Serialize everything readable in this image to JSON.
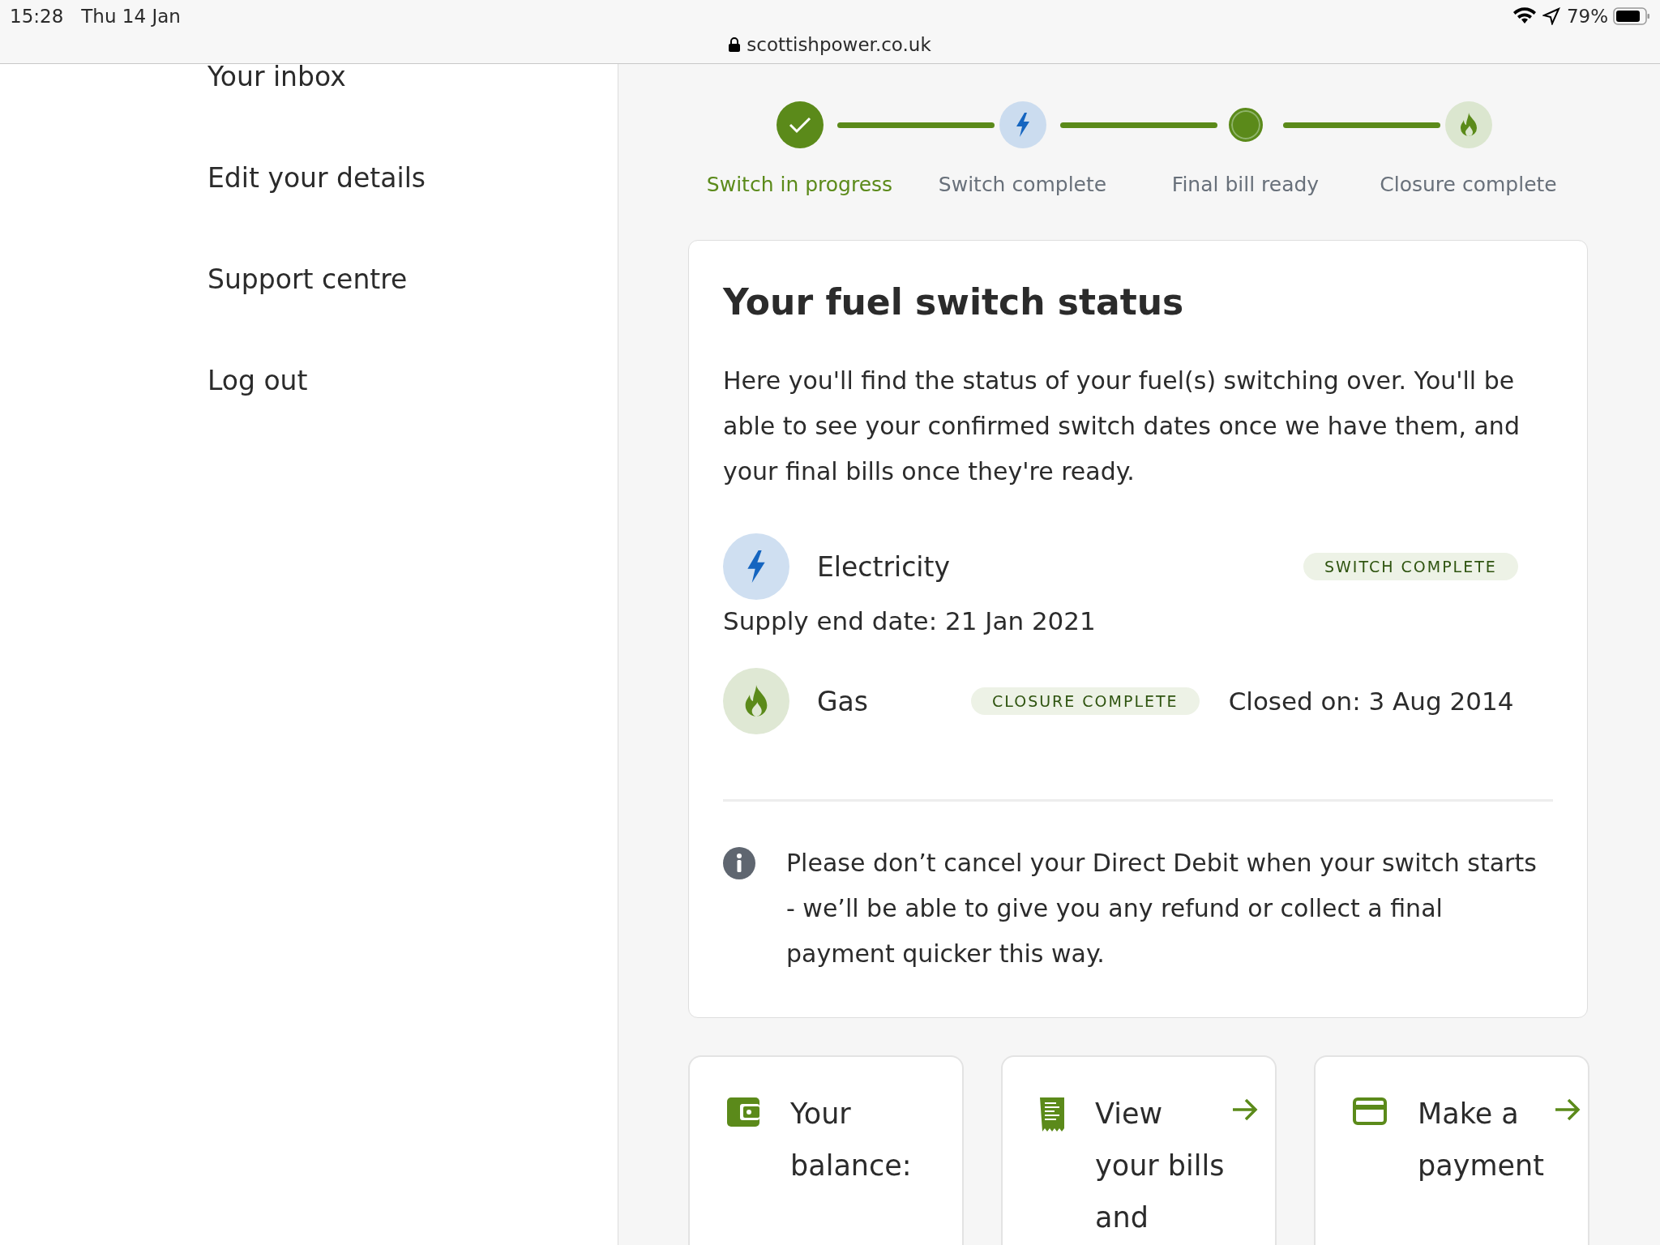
{
  "status_bar": {
    "time": "15:28",
    "date": "Thu 14 Jan",
    "url": "scottishpower.co.uk",
    "battery": "79%"
  },
  "sidebar": {
    "items": [
      {
        "label": "Your inbox"
      },
      {
        "label": "Edit your details"
      },
      {
        "label": "Support centre"
      },
      {
        "label": "Log out"
      }
    ]
  },
  "stepper": [
    {
      "label": "Switch in progress",
      "kind": "done",
      "selected": true
    },
    {
      "label": "Switch complete",
      "kind": "electricity",
      "selected": false
    },
    {
      "label": "Final bill ready",
      "kind": "current",
      "selected": false
    },
    {
      "label": "Closure complete",
      "kind": "gas",
      "selected": false
    }
  ],
  "status_card": {
    "title": "Your fuel switch status",
    "intro": "Here you'll find the status of your fuel(s) switching over. You'll be able to see your confirmed switch dates once we have them, and your final bills once they're ready.",
    "fuels": [
      {
        "kind": "electricity",
        "name": "Electricity",
        "badge": "SWITCH COMPLETE",
        "note": "Supply end date: 21 Jan 2021"
      },
      {
        "kind": "gas",
        "name": "Gas",
        "badge": "CLOSURE COMPLETE",
        "note": "Closed on: 3 Aug 2014"
      }
    ],
    "info": "Please don’t cancel your Direct Debit when your switch starts - we’ll be able to give you any refund or collect a final payment quicker this way."
  },
  "action_cards": [
    {
      "kind": "wallet",
      "label": "Your balance:",
      "arrow": false
    },
    {
      "kind": "bill",
      "label": "View your bills and",
      "arrow": true
    },
    {
      "kind": "card",
      "label": "Make a payment",
      "arrow": true
    }
  ]
}
